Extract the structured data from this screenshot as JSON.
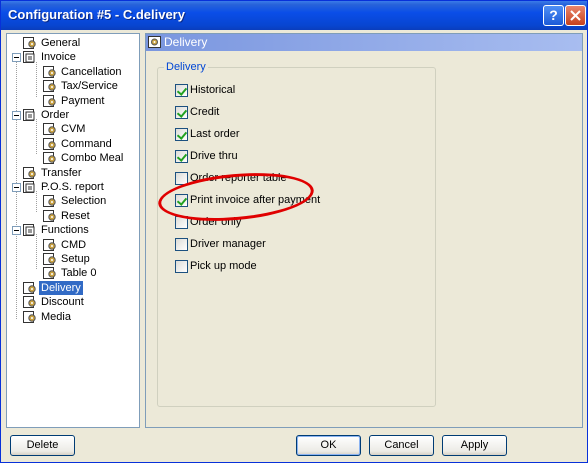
{
  "window": {
    "title": "Configuration #5 - C.delivery"
  },
  "titlebar_buttons": {
    "help": "?"
  },
  "tree": {
    "items": [
      {
        "label": "General",
        "icon": "gear-page-icon"
      },
      {
        "label": "Invoice",
        "icon": "folder-page-icon"
      },
      {
        "label": "Cancellation",
        "icon": "gear-page-icon"
      },
      {
        "label": "Tax/Service",
        "icon": "gear-page-icon"
      },
      {
        "label": "Payment",
        "icon": "gear-page-icon"
      },
      {
        "label": "Order",
        "icon": "folder-page-icon"
      },
      {
        "label": "CVM",
        "icon": "gear-page-icon"
      },
      {
        "label": "Command",
        "icon": "gear-page-icon"
      },
      {
        "label": "Combo Meal",
        "icon": "gear-page-icon"
      },
      {
        "label": "Transfer",
        "icon": "gear-page-icon"
      },
      {
        "label": "P.O.S. report",
        "icon": "folder-page-icon"
      },
      {
        "label": "Selection",
        "icon": "gear-page-icon"
      },
      {
        "label": "Reset",
        "icon": "gear-page-icon"
      },
      {
        "label": "Functions",
        "icon": "folder-page-icon"
      },
      {
        "label": "CMD",
        "icon": "gear-page-icon"
      },
      {
        "label": "Setup",
        "icon": "gear-page-icon"
      },
      {
        "label": "Table 0",
        "icon": "gear-page-icon"
      },
      {
        "label": "Delivery",
        "icon": "gear-page-icon",
        "selected": true
      },
      {
        "label": "Discount",
        "icon": "gear-page-icon"
      },
      {
        "label": "Media",
        "icon": "gear-page-icon"
      }
    ]
  },
  "panel": {
    "title": "Delivery",
    "group_label": "Delivery",
    "options": [
      {
        "label": "Historical",
        "checked": true
      },
      {
        "label": "Credit",
        "checked": true
      },
      {
        "label": "Last order",
        "checked": true
      },
      {
        "label": "Drive thru",
        "checked": true
      },
      {
        "label": "Order reporter table",
        "checked": false
      },
      {
        "label": "Print invoice after payment",
        "checked": true,
        "highlighted": true
      },
      {
        "label": "Order only",
        "checked": false
      },
      {
        "label": "Driver manager",
        "checked": false
      },
      {
        "label": "Pick up mode",
        "checked": false
      }
    ],
    "highlight_color": "#e00000"
  },
  "buttons": {
    "delete": "Delete",
    "ok": "OK",
    "cancel": "Cancel",
    "apply": "Apply"
  },
  "colors": {
    "titlebar": "#0a4ee8",
    "selection": "#316ac5",
    "panel_header": "#7a96df",
    "check": "#21a121"
  }
}
